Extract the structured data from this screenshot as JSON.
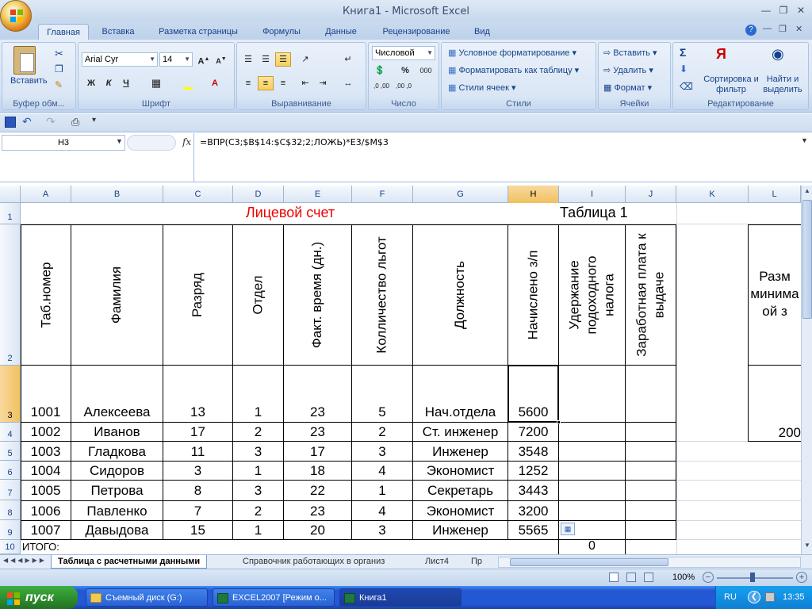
{
  "window": {
    "title": "Книга1 - Microsoft Excel"
  },
  "tabs": [
    "Главная",
    "Вставка",
    "Разметка страницы",
    "Формулы",
    "Данные",
    "Рецензирование",
    "Вид"
  ],
  "ribbon": {
    "clipboard": {
      "label": "Буфер обм...",
      "paste": "Вставить"
    },
    "font": {
      "label": "Шрифт",
      "name": "Arial Cyr",
      "size": "14",
      "bold": "Ж",
      "italic": "К",
      "underline": "Ч"
    },
    "alignment": {
      "label": "Выравнивание"
    },
    "number": {
      "label": "Число",
      "format": "Числовой"
    },
    "styles": {
      "label": "Стили",
      "conditional": "Условное форматирование",
      "table": "Форматировать как таблицу",
      "cell_styles": "Стили ячеек"
    },
    "cells": {
      "label": "Ячейки",
      "insert": "Вставить",
      "delete": "Удалить",
      "format": "Формат"
    },
    "editing": {
      "label": "Редактирование",
      "sort": "Сортировка и фильтр",
      "find": "Найти и выделить"
    }
  },
  "formula_bar": {
    "name_box": "H3",
    "fx": "fx",
    "formula": "=ВПР(C3;$B$14:$C$32;2;ЛОЖЬ)*E3/$M$3"
  },
  "columns": [
    "A",
    "B",
    "C",
    "D",
    "E",
    "F",
    "G",
    "H",
    "I",
    "J",
    "K",
    "L"
  ],
  "rows": [
    "1",
    "2",
    "3",
    "4",
    "5",
    "6",
    "7",
    "8",
    "9",
    "10"
  ],
  "sheet": {
    "title": "Лицевой счет",
    "table_label": "Таблица 1",
    "headers": {
      "A": "Таб.номер",
      "B": "Фамилия",
      "C": "Разряд",
      "D": "Отдел",
      "E": "Факт. время (дн.)",
      "F": "Колличество льгот",
      "G": "Должность",
      "H": "Начислено з/п",
      "I": "Удержание\nподоходного\nналога",
      "J": "Заработная плата к\nвыдаче"
    },
    "side_header": "Разм\nминима\nой з",
    "side_value": "200",
    "data": [
      [
        "1001",
        "Алексеева",
        "13",
        "1",
        "23",
        "5",
        "Нач.отдела",
        "5600"
      ],
      [
        "1002",
        "Иванов",
        "17",
        "2",
        "23",
        "2",
        "Ст. инженер",
        "7200"
      ],
      [
        "1003",
        "Гладкова",
        "11",
        "3",
        "17",
        "3",
        "Инженер",
        "3548"
      ],
      [
        "1004",
        "Сидоров",
        "3",
        "1",
        "18",
        "4",
        "Экономист",
        "1252"
      ],
      [
        "1005",
        "Петрова",
        "8",
        "3",
        "22",
        "1",
        "Секретарь",
        "3443"
      ],
      [
        "1006",
        "Павленко",
        "7",
        "2",
        "23",
        "4",
        "Экономист",
        "3200"
      ],
      [
        "1007",
        "Давыдова",
        "15",
        "1",
        "20",
        "3",
        "Инженер",
        "5565"
      ]
    ],
    "total_label": "ИТОГО:",
    "total_value": "0"
  },
  "sheet_tabs": [
    "Таблица с расчетными данными",
    "Справочник работающих в организ",
    "Лист4",
    "Пр"
  ],
  "status": {
    "zoom": "100%"
  },
  "taskbar": {
    "start": "пуск",
    "items": [
      "Съемный диск (G:)",
      "EXCEL2007 [Режим о...",
      "Книга1"
    ],
    "lang": "RU",
    "clock": "13:35"
  }
}
